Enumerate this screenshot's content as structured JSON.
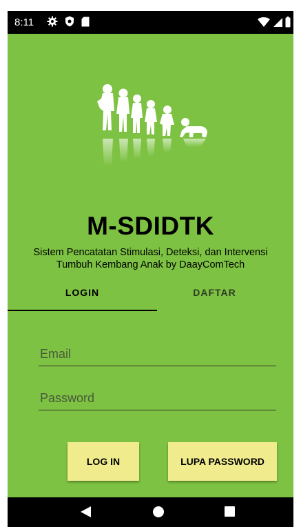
{
  "status_bar": {
    "time": "8:11",
    "left_icons": [
      "gear-icon",
      "shield-icon",
      "sd-card-icon"
    ],
    "right_icons": [
      "wifi-icon",
      "signal-icon",
      "battery-icon"
    ]
  },
  "app": {
    "illustration": "children-growth-silhouette",
    "title": "M-SDIDTK",
    "subtitle_line1": "Sistem Pencatatan Stimulasi, Deteksi, dan Intervensi",
    "subtitle_line2": "Tumbuh Kembang Anak by DaayComTech",
    "tabs": [
      {
        "label": "LOGIN",
        "active": true
      },
      {
        "label": "DAFTAR",
        "active": false
      }
    ],
    "email": {
      "placeholder": "Email",
      "value": ""
    },
    "password": {
      "placeholder": "Password",
      "value": ""
    },
    "login_button": "LOG IN",
    "forgot_button": "LUPA PASSWORD"
  },
  "nav_bar": {
    "icons": [
      "back-icon",
      "home-icon",
      "recents-icon"
    ]
  },
  "colors": {
    "background": "#7DC242",
    "button": "#F0EC8E",
    "text": "#000000",
    "status_bar": "#000000"
  }
}
